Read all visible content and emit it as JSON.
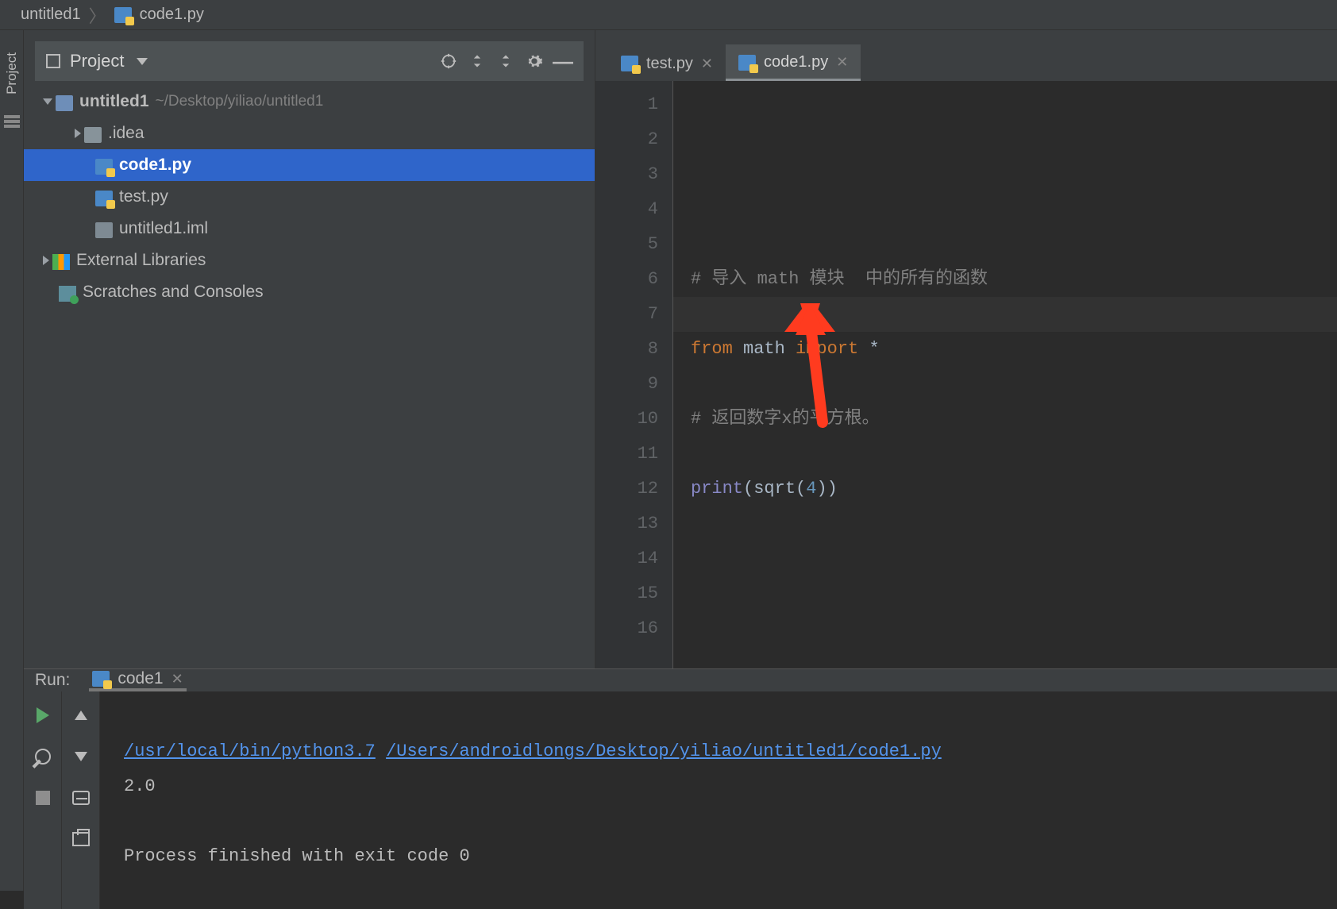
{
  "breadcrumb": {
    "root": "untitled1",
    "file": "code1.py"
  },
  "leftStrip": {
    "project": "Project"
  },
  "projectPanel": {
    "title": "Project",
    "tree": {
      "root": {
        "name": "untitled1",
        "path": "~/Desktop/yiliao/untitled1"
      },
      "idea": ".idea",
      "code1": "code1.py",
      "test": "test.py",
      "iml": "untitled1.iml",
      "ext": "External Libraries",
      "scratch": "Scratches and Consoles"
    }
  },
  "editor": {
    "tabs": [
      {
        "label": "test.py",
        "active": false
      },
      {
        "label": "code1.py",
        "active": true
      }
    ],
    "gutter": [
      "1",
      "2",
      "3",
      "4",
      "5",
      "6",
      "7",
      "8",
      "9",
      "10",
      "11",
      "12",
      "13",
      "14",
      "15",
      "16"
    ],
    "code": {
      "l3_comment": "# 导入 math 模块  中的所有的函数",
      "l4_from": "from",
      "l4_math": "math",
      "l4_import": "import",
      "l4_star": "*",
      "l5_comment": "# 返回数字x的平方根。",
      "l6_print": "print",
      "l6_open": "(",
      "l6_sqrt": "sqrt",
      "l6_open2": "(",
      "l6_num": "4",
      "l6_close": "))"
    }
  },
  "run": {
    "label": "Run:",
    "tab": "code1",
    "console": {
      "interp": "/usr/local/bin/python3.7",
      "script": "/Users/androidlongs/Desktop/yiliao/untitled1/code1.py",
      "output": "2.0",
      "exit": "Process finished with exit code 0"
    }
  }
}
